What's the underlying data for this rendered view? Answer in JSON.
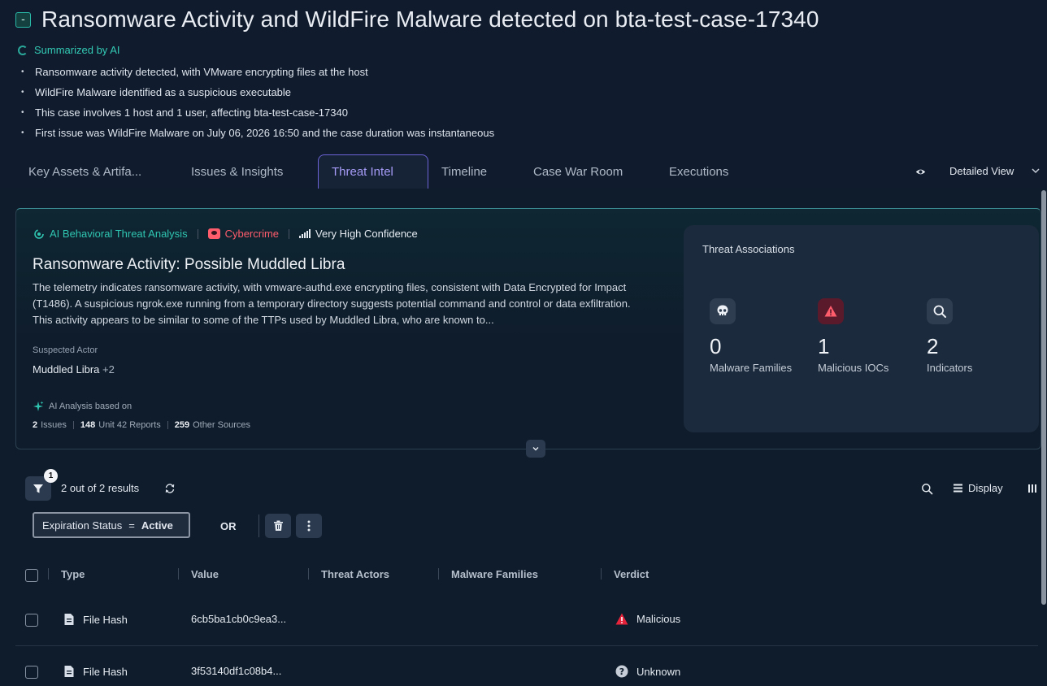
{
  "header": {
    "collapse_symbol": "-",
    "title": "Ransomware Activity and WildFire Malware detected on bta-test-case-17340",
    "ai_summary_label": "Summarized by AI",
    "summary": [
      "Ransomware activity detected, with VMware encrypting files at the host",
      "WildFire Malware identified as a suspicious executable",
      "This case involves 1 host and 1 user, affecting bta-test-case-17340",
      "First issue was WildFire Malware on July 06, 2026 16:50 and the case duration was instantaneous"
    ]
  },
  "tabs": [
    {
      "label": "Key Assets & Artifa..."
    },
    {
      "label": "Issues & Insights"
    },
    {
      "label": "Threat Intel"
    },
    {
      "label": "Timeline"
    },
    {
      "label": "Case War Room"
    },
    {
      "label": "Executions"
    }
  ],
  "active_tab": "Threat Intel",
  "view_selector": {
    "label": "Detailed View"
  },
  "intel": {
    "badge_ai": "AI Behavioral Threat Analysis",
    "badge_category": "Cybercrime",
    "badge_confidence": "Very High Confidence",
    "title": "Ransomware Activity: Possible Muddled Libra",
    "description": "The telemetry indicates ransomware activity, with vmware-authd.exe encrypting files, consistent with Data Encrypted for Impact (T1486). A suspicious ngrok.exe running from a temporary directory suggests potential command and control or data exfiltration. This activity appears to be similar to some of the TTPs used by Muddled Libra, who are known to...",
    "suspected_actor_label": "Suspected Actor",
    "suspected_actor": "Muddled Libra",
    "suspected_actor_more": "+2",
    "basis_label": "AI Analysis based on",
    "basis": {
      "issues_count": "2",
      "issues_label": "Issues",
      "reports_count": "148",
      "reports_label": "Unit 42 Reports",
      "sources_count": "259",
      "sources_label": "Other Sources"
    }
  },
  "associations": {
    "title": "Threat Associations",
    "items": [
      {
        "icon": "skull-icon",
        "count": "0",
        "label": "Malware Families"
      },
      {
        "icon": "warning-icon",
        "count": "1",
        "label": "Malicious IOCs"
      },
      {
        "icon": "search-icon",
        "count": "2",
        "label": "Indicators"
      }
    ]
  },
  "toolbar": {
    "filter_count": "1",
    "results": "2 out of 2 results",
    "display_label": "Display"
  },
  "filter": {
    "field": "Expiration Status",
    "operator": "=",
    "value": "Active",
    "or_label": "OR"
  },
  "table": {
    "columns": [
      "Type",
      "Value",
      "Threat Actors",
      "Malware Families",
      "Verdict"
    ],
    "rows": [
      {
        "type": "File Hash",
        "value": "6cb5ba1cb0c9ea3...",
        "threat_actors": "",
        "malware_families": "",
        "verdict": "Malicious"
      },
      {
        "type": "File Hash",
        "value": "3f53140df1c08b4...",
        "threat_actors": "",
        "malware_families": "",
        "verdict": "Unknown"
      }
    ]
  },
  "colors": {
    "background": "#101c2d",
    "accent_teal": "#2fc4b0",
    "accent_purple": "#a69cf7",
    "danger": "#ff5c6c",
    "malicious": "#e5243b"
  }
}
